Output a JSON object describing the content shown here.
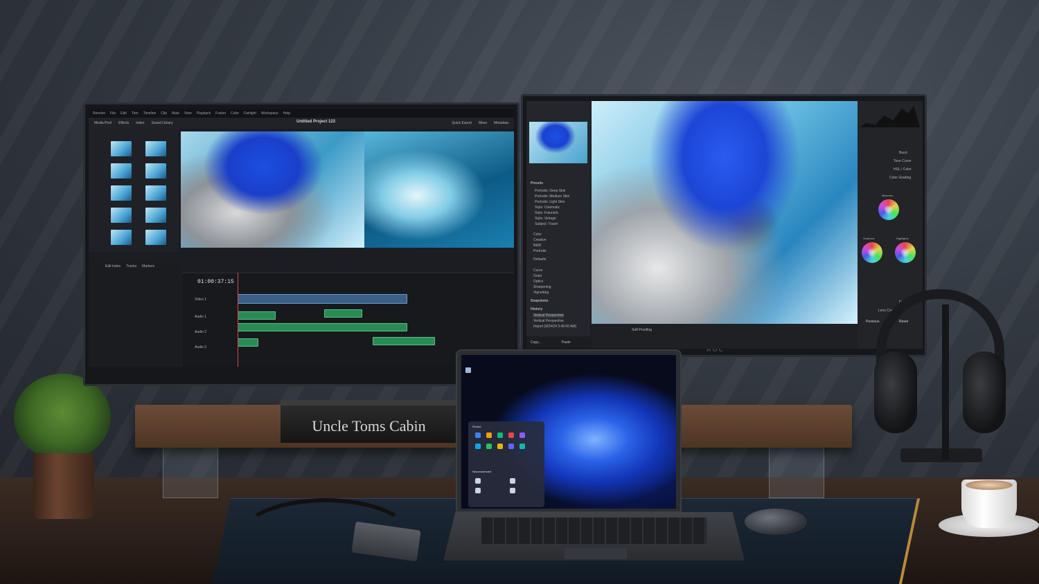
{
  "scene": {
    "book_title": "Uncle Toms Cabin",
    "monitor_brand": "AOC",
    "colors": {
      "wall": "#343a42",
      "desk": "#2a1f1a",
      "accent_blue": "#1d45d6",
      "desk_mat_trim": "#b98b3a"
    }
  },
  "left_monitor": {
    "app": "video-editor",
    "menu_items": [
      "Resolve",
      "File",
      "Edit",
      "Trim",
      "Timeline",
      "Clip",
      "Mark",
      "View",
      "Playback",
      "Fusion",
      "Color",
      "Fairlight",
      "Workspace",
      "Help"
    ],
    "toolbar_items": [
      "Media Pool",
      "Effects",
      "Index",
      "Sound Library"
    ],
    "project_title": "Untitled Project 123",
    "timecode": "01:00:37:15",
    "tracks": [
      "Video 1",
      "Audio 1",
      "Audio 2",
      "Audio 3"
    ],
    "index_tabs": [
      "Edit Index",
      "Tracks",
      "Markers"
    ],
    "right_toolbar": [
      "Quick Export",
      "Mixer",
      "Metadata"
    ]
  },
  "right_monitor": {
    "app": "photo-editor",
    "left_sections": [
      "Presets",
      "Snapshots",
      "History"
    ],
    "presets": [
      "Portraits: Deep Skin",
      "Portraits: Medium Skin",
      "Portraits: Light Skin",
      "Style: Cinematic",
      "Style: Futuristic",
      "Style: Vintage",
      "Subject: Travel"
    ],
    "preset_groups": [
      "Color",
      "Creative",
      "B&W",
      "Portraits",
      "Defaults",
      "Curve",
      "Grain",
      "Optics",
      "Sharpening",
      "Vignetting"
    ],
    "history_items": [
      "Vertical Perspective",
      "Vertical Perspective",
      "Import (9/24/24 3:46:00 AM)"
    ],
    "right_sections": [
      "Basic",
      "Tone Curve",
      "HSL / Color",
      "Color Grading",
      "Detail",
      "Lens Corrections"
    ],
    "wheel_labels": [
      "Midtones",
      "Shadows",
      "Highlights"
    ],
    "footer_buttons": [
      "Copy...",
      "Paste",
      "Previous",
      "Reset"
    ],
    "bottom_bar": "Soft Proofing"
  },
  "laptop": {
    "os": "windows-11",
    "start_sections": [
      "Pinned",
      "Recommended"
    ]
  }
}
